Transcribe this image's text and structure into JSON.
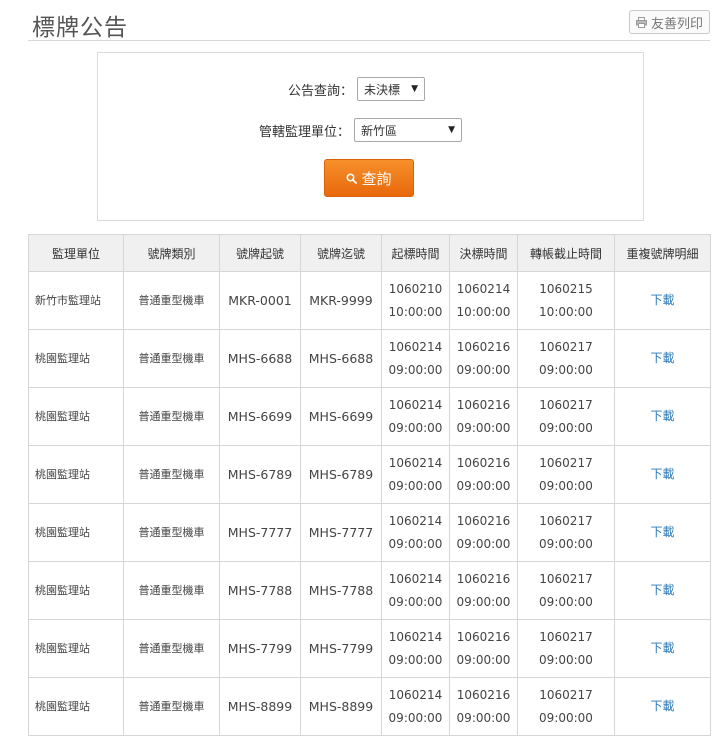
{
  "header": {
    "title": "標牌公告",
    "print_label": "友善列印"
  },
  "query": {
    "announce_label": "公告查詢：",
    "announce_value": "未決標",
    "office_label": "管轄監理單位：",
    "office_value": "新竹區",
    "search_label": "查詢"
  },
  "table": {
    "columns": [
      "監理單位",
      "號牌類別",
      "號牌起號",
      "號牌迄號",
      "起標時間",
      "決標時間",
      "轉帳截止時間",
      "重複號牌明細"
    ],
    "rows": [
      {
        "unit": "新竹市監理站",
        "type": "普通重型機車",
        "start": "MKR-0001",
        "end": "MKR-9999",
        "bid_start_date": "1060210",
        "bid_start_time": "10:00:00",
        "award_date": "1060214",
        "award_time": "10:00:00",
        "deadline_date": "1060215",
        "deadline_time": "10:00:00",
        "detail": "下載"
      },
      {
        "unit": "桃園監理站",
        "type": "普通重型機車",
        "start": "MHS-6688",
        "end": "MHS-6688",
        "bid_start_date": "1060214",
        "bid_start_time": "09:00:00",
        "award_date": "1060216",
        "award_time": "09:00:00",
        "deadline_date": "1060217",
        "deadline_time": "09:00:00",
        "detail": "下載"
      },
      {
        "unit": "桃園監理站",
        "type": "普通重型機車",
        "start": "MHS-6699",
        "end": "MHS-6699",
        "bid_start_date": "1060214",
        "bid_start_time": "09:00:00",
        "award_date": "1060216",
        "award_time": "09:00:00",
        "deadline_date": "1060217",
        "deadline_time": "09:00:00",
        "detail": "下載"
      },
      {
        "unit": "桃園監理站",
        "type": "普通重型機車",
        "start": "MHS-6789",
        "end": "MHS-6789",
        "bid_start_date": "1060214",
        "bid_start_time": "09:00:00",
        "award_date": "1060216",
        "award_time": "09:00:00",
        "deadline_date": "1060217",
        "deadline_time": "09:00:00",
        "detail": "下載"
      },
      {
        "unit": "桃園監理站",
        "type": "普通重型機車",
        "start": "MHS-7777",
        "end": "MHS-7777",
        "bid_start_date": "1060214",
        "bid_start_time": "09:00:00",
        "award_date": "1060216",
        "award_time": "09:00:00",
        "deadline_date": "1060217",
        "deadline_time": "09:00:00",
        "detail": "下載"
      },
      {
        "unit": "桃園監理站",
        "type": "普通重型機車",
        "start": "MHS-7788",
        "end": "MHS-7788",
        "bid_start_date": "1060214",
        "bid_start_time": "09:00:00",
        "award_date": "1060216",
        "award_time": "09:00:00",
        "deadline_date": "1060217",
        "deadline_time": "09:00:00",
        "detail": "下載"
      },
      {
        "unit": "桃園監理站",
        "type": "普通重型機車",
        "start": "MHS-7799",
        "end": "MHS-7799",
        "bid_start_date": "1060214",
        "bid_start_time": "09:00:00",
        "award_date": "1060216",
        "award_time": "09:00:00",
        "deadline_date": "1060217",
        "deadline_time": "09:00:00",
        "detail": "下載"
      },
      {
        "unit": "桃園監理站",
        "type": "普通重型機車",
        "start": "MHS-8899",
        "end": "MHS-8899",
        "bid_start_date": "1060214",
        "bid_start_time": "09:00:00",
        "award_date": "1060216",
        "award_time": "09:00:00",
        "deadline_date": "1060217",
        "deadline_time": "09:00:00",
        "detail": "下載"
      }
    ]
  }
}
